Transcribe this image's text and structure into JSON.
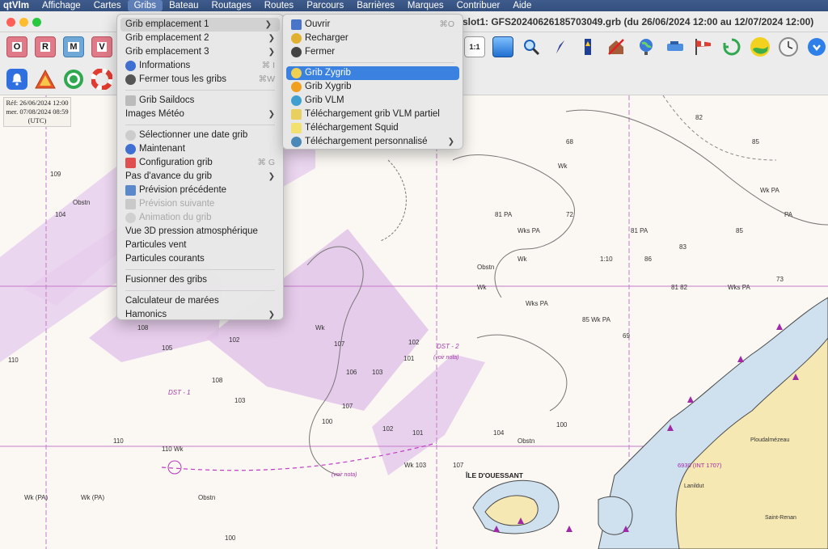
{
  "menubar": {
    "items": [
      "qtVlm",
      "Affichage",
      "Cartes",
      "Gribs",
      "Bateau",
      "Routages",
      "Routes",
      "Parcours",
      "Barrières",
      "Marques",
      "Contribuer",
      "Aide"
    ]
  },
  "window": {
    "title": "slot1: GFS20240626185703049.grb (du 26/06/2024 12:00 au 12/07/2024 12:00)"
  },
  "toolbar": {
    "layer_buttons": [
      "O",
      "R",
      "M",
      "V"
    ]
  },
  "ref_box": {
    "line1": "Réf: 26/06/2024 12:00",
    "line2": "mer. 07/08/2024 08:59",
    "line3": "(UTC)"
  },
  "gribs_menu": {
    "items": [
      {
        "label": "Grib emplacement 1",
        "submenu": true
      },
      {
        "label": "Grib emplacement 2",
        "submenu": true
      },
      {
        "label": "Grib emplacement 3",
        "submenu": true
      },
      {
        "label": "Informations",
        "shortcut": "⌘ I"
      },
      {
        "label": "Fermer tous les gribs",
        "shortcut": "⌘W"
      },
      {
        "label": "Grib Saildocs"
      },
      {
        "label": "Images Météo",
        "submenu": true
      },
      {
        "label": "Sélectionner une date grib"
      },
      {
        "label": "Maintenant"
      },
      {
        "label": "Configuration grib",
        "shortcut": "⌘ G"
      },
      {
        "label": "Pas d'avance du grib",
        "submenu": true
      },
      {
        "label": "Prévision précédente"
      },
      {
        "label": "Prévision suivante"
      },
      {
        "label": "Animation du grib"
      },
      {
        "label": "Vue 3D pression atmosphérique"
      },
      {
        "label": "Particules vent"
      },
      {
        "label": "Particules courants"
      },
      {
        "label": "Fusionner des gribs"
      },
      {
        "label": "Calculateur de marées"
      },
      {
        "label": "Hamonics",
        "submenu": true
      }
    ]
  },
  "grib1_submenu": {
    "items": [
      {
        "label": "Ouvrir",
        "shortcut": "⌘O"
      },
      {
        "label": "Recharger"
      },
      {
        "label": "Fermer"
      },
      {
        "label": "Grib Zygrib"
      },
      {
        "label": "Grib Xygrib"
      },
      {
        "label": "Grib VLM"
      },
      {
        "label": "Téléchargement grib VLM partiel"
      },
      {
        "label": "Téléchargement Squid"
      },
      {
        "label": "Téléchargement personnalisé",
        "submenu": true
      }
    ]
  },
  "map_labels": {
    "island": "ÎLE D'OUESSANT",
    "dst1": "DST - 1",
    "dst2": "DST - 2",
    "dst_note": "(voir nota)",
    "chart_ref": "6930 (INT 1707)",
    "ploudalmezeau": "Ploudalmézeau",
    "lanildut": "Lanildut",
    "saint_renan": "Saint-Renan"
  },
  "colors": {
    "menu_highlight": "#3b82e0",
    "land": "#f6e8b3",
    "shallow": "#cfe0ef",
    "tss_zone": "#e3c7ea"
  }
}
